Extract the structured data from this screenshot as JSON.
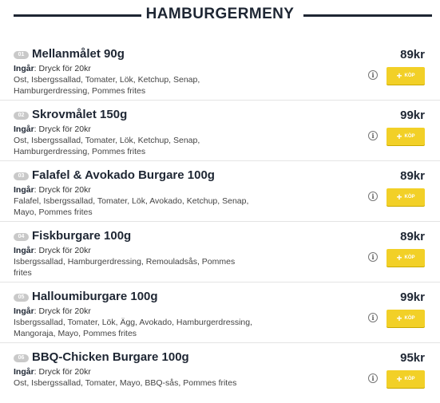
{
  "header": {
    "title": "HAMBURGERMENY"
  },
  "common": {
    "includes_label": "Ingår",
    "info_icon": "info-icon",
    "buy_label": "KÖP",
    "buy_icon": "plus-icon"
  },
  "items": [
    {
      "num": "01",
      "name": "Mellanmålet 90g",
      "includes": ": Dryck för 20kr",
      "desc": "Ost, Isbergssallad, Tomater, Lök, Ketchup, Senap, Hamburgerdressing, Pommes frites",
      "price": "89kr"
    },
    {
      "num": "02",
      "name": "Skrovmålet 150g",
      "includes": ": Dryck för 20kr",
      "desc": "Ost, Isbergssallad, Tomater, Lök, Ketchup, Senap, Hamburgerdressing, Pommes frites",
      "price": "99kr"
    },
    {
      "num": "03",
      "name": "Falafel & Avokado Burgare 100g",
      "includes": ": Dryck för 20kr",
      "desc": "Falafel, Isbergssallad, Tomater, Lök, Avokado, Ketchup, Senap, Mayo, Pommes frites",
      "price": "89kr"
    },
    {
      "num": "04",
      "name": "Fiskburgare 100g",
      "includes": ": Dryck för 20kr",
      "desc": "Isbergssallad, Hamburgerdressing, Remouladsås, Pommes frites",
      "price": "89kr"
    },
    {
      "num": "05",
      "name": "Halloumiburgare 100g",
      "includes": ": Dryck för 20kr",
      "desc": "Isbergssallad, Tomater, Lök, Ägg, Avokado, Hamburgerdressing, Mangoraja, Mayo, Pommes frites",
      "price": "99kr"
    },
    {
      "num": "06",
      "name": "BBQ-Chicken Burgare 100g",
      "includes": ": Dryck för 20kr",
      "desc": "Ost, Isbergssallad, Tomater, Mayo, BBQ-sås, Pommes frites",
      "price": "95kr"
    }
  ]
}
